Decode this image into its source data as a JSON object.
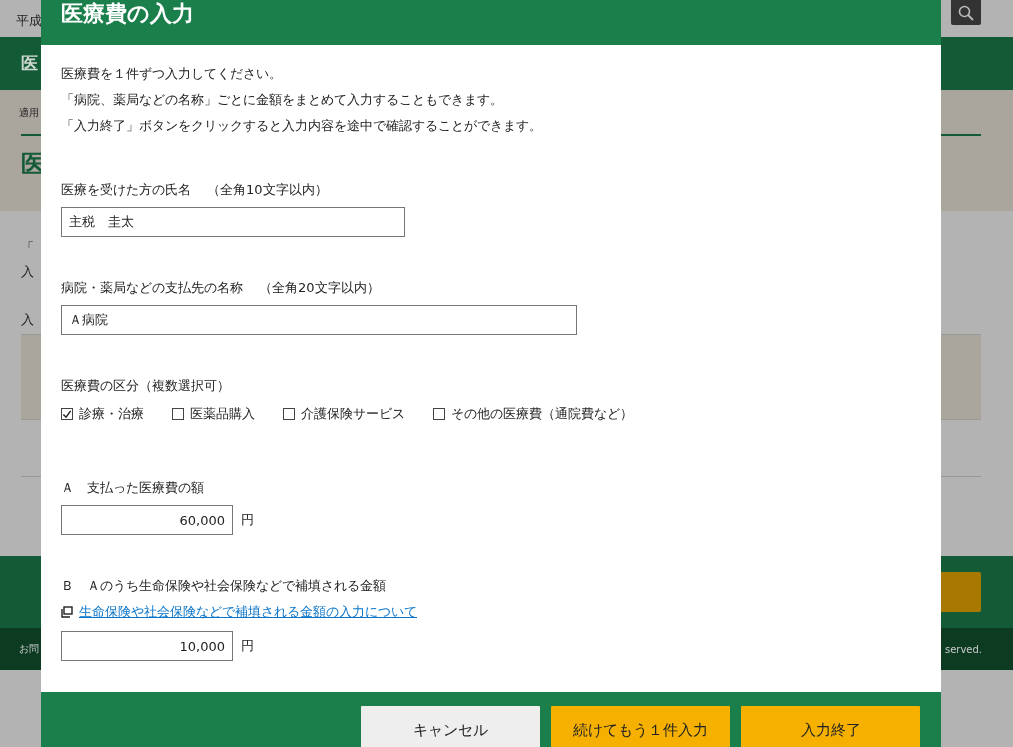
{
  "background": {
    "header_fragment": "平成",
    "nav_fragment": "医",
    "breadcrumb_fragment": "適用",
    "heading_fragment": "医",
    "text_fragments": [
      "「",
      "入",
      "入"
    ],
    "footer_fragment_left": "お問",
    "footer_fragment_right": "served."
  },
  "dialog": {
    "title": "医療費の入力",
    "instructions": [
      "医療費を１件ずつ入力してください。",
      "「病院、薬局などの名称」ごとに金額をまとめて入力することもできます。",
      "「入力終了」ボタンをクリックすると入力内容を途中で確認することができます。"
    ],
    "patient": {
      "label": "医療を受けた方の氏名",
      "hint": "（全角10文字以内）",
      "value": "主税　圭太"
    },
    "payee": {
      "label": "病院・薬局などの支払先の名称",
      "hint": "（全角20文字以内）",
      "value": "Ａ病院"
    },
    "categories": {
      "label": "医療費の区分（複数選択可）",
      "options": [
        {
          "label": "診療・治療",
          "checked": true
        },
        {
          "label": "医薬品購入",
          "checked": false
        },
        {
          "label": "介護保険サービス",
          "checked": false
        },
        {
          "label": "その他の医療費（通院費など）",
          "checked": false
        }
      ]
    },
    "amount_a": {
      "label": "Ａ　支払った医療費の額",
      "value": "60,000",
      "unit": "円"
    },
    "amount_b": {
      "label": "Ｂ　Ａのうち生命保険や社会保険などで補填される金額",
      "link": "生命保険や社会保険などで補填される金額の入力について",
      "value": "10,000",
      "unit": "円"
    },
    "buttons": [
      {
        "label": "キャンセル",
        "kind": "secondary"
      },
      {
        "label": "続けてもう１件入力",
        "kind": "primary"
      },
      {
        "label": "入力終了",
        "kind": "primary"
      }
    ]
  }
}
